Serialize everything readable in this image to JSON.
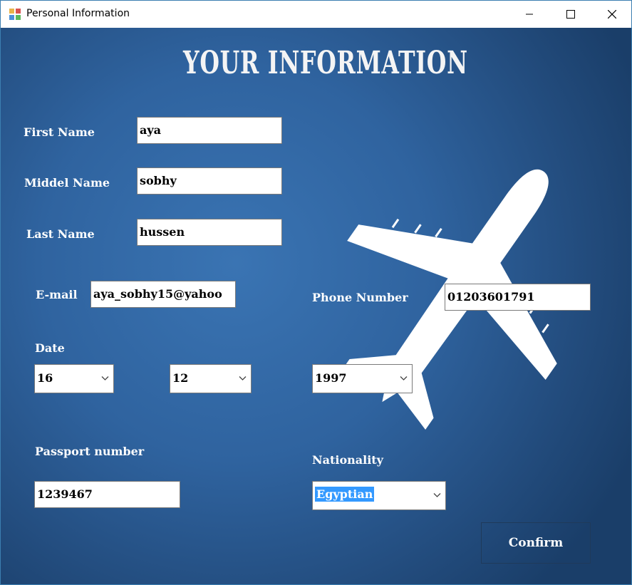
{
  "window": {
    "title": "Personal Information"
  },
  "heading": "YOUR INFORMATION",
  "form": {
    "first_name": {
      "label": "First Name",
      "value": "aya"
    },
    "middle_name": {
      "label": "Middel Name",
      "value": "sobhy"
    },
    "last_name": {
      "label": "Last Name",
      "value": "hussen"
    },
    "email": {
      "label": "E-mail",
      "value": "aya_sobhy15@yahoo"
    },
    "phone": {
      "label": "Phone Number",
      "value": "01203601791"
    },
    "date": {
      "label": "Date",
      "day": "16",
      "month": "12",
      "year": "1997"
    },
    "passport": {
      "label": "Passport number",
      "value": "1239467"
    },
    "nationality": {
      "label": "Nationality",
      "value": "Egyptian"
    }
  },
  "confirm_label": "Confirm",
  "colors": {
    "accent": "#3399ff",
    "background": "#2f639f"
  }
}
